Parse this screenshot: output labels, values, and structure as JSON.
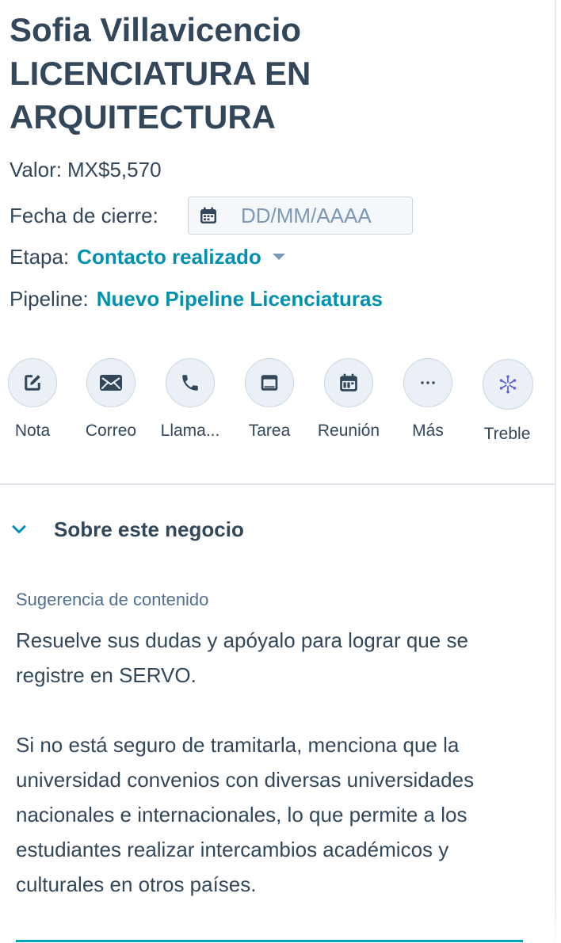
{
  "header": {
    "title_lines": [
      "Sofia Villavicencio",
      "LICENCIATURA EN",
      "ARQUITECTURA"
    ]
  },
  "properties": {
    "valor": {
      "label": "Valor:",
      "value": "MX$5,570"
    },
    "fecha_cierre": {
      "label": "Fecha de cierre:",
      "placeholder": "DD/MM/AAAA",
      "icon": "calendar-icon"
    },
    "etapa": {
      "label": "Etapa:",
      "value": "Contacto realizado"
    },
    "pipeline": {
      "label": "Pipeline:",
      "value": "Nuevo Pipeline Licenciaturas"
    }
  },
  "actions": [
    {
      "label": "Nota",
      "icon": "edit-note-icon"
    },
    {
      "label": "Correo",
      "icon": "envelope-icon"
    },
    {
      "label": "Llama...",
      "icon": "phone-icon"
    },
    {
      "label": "Tarea",
      "icon": "task-icon"
    },
    {
      "label": "Reunión",
      "icon": "calendar-meeting-icon"
    },
    {
      "label": "Más",
      "icon": "more-icon"
    },
    {
      "label": "Treble",
      "icon": "treble-icon"
    }
  ],
  "section": {
    "title": "Sobre este negocio",
    "suggestion_label": "Sugerencia de contenido",
    "paragraphs": [
      "Resuelve sus dudas y apóyalo para lograr que se registre en SERVO.",
      "Si no está seguro de tramitarla, menciona que la universidad convenios con diversas universidades nacionales e internacionales, lo que permite a los estudiantes realizar intercambios académicos y culturales en otros países."
    ]
  },
  "colors": {
    "text": "#33475b",
    "link": "#0091ae",
    "placeholder": "#7c98b6",
    "button_bg": "#eaf0f6",
    "accent_line": "#00a4bd"
  }
}
